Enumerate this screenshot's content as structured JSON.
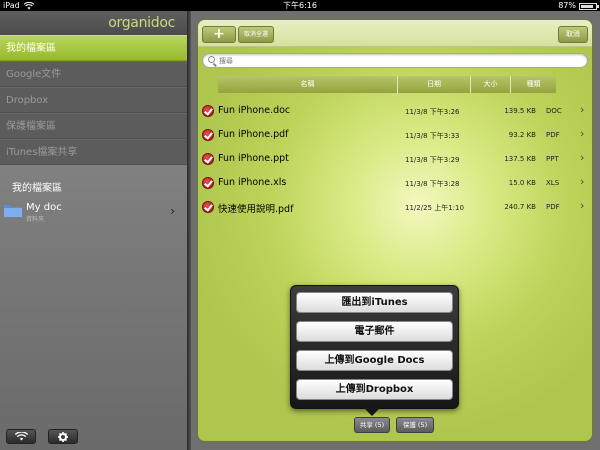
{
  "statusbar": {
    "device": "iPad",
    "time": "下午6:16",
    "battery": "87%",
    "battery_level": 0.87
  },
  "sidebar": {
    "logo": "organidoc",
    "menu": [
      {
        "label": "我的檔案區",
        "active": true
      },
      {
        "label": "Google文件",
        "active": false
      },
      {
        "label": "Dropbox",
        "active": false
      },
      {
        "label": "保護檔案區",
        "active": false
      },
      {
        "label": "iTunes檔案共享",
        "active": false
      }
    ],
    "section_title": "我的檔案區",
    "folder": {
      "name": "My doc",
      "sub": "資料夾"
    }
  },
  "toolbar": {
    "add_label": "+",
    "select_all_label": "取消全選",
    "cancel_label": "取消"
  },
  "search": {
    "placeholder": "搜尋"
  },
  "table": {
    "columns": {
      "name": "名稱",
      "date": "日期",
      "size": "大小",
      "type": "種類"
    },
    "rows": [
      {
        "name": "Fun iPhone.doc",
        "date": "11/3/8 下午3:26",
        "size": "139.5 KB",
        "type": "DOC"
      },
      {
        "name": "Fun iPhone.pdf",
        "date": "11/3/8 下午3:33",
        "size": "93.2 KB",
        "type": "PDF"
      },
      {
        "name": "Fun iPhone.ppt",
        "date": "11/3/8 下午3:29",
        "size": "137.5 KB",
        "type": "PPT"
      },
      {
        "name": "Fun iPhone.xls",
        "date": "11/3/8 下午3:28",
        "size": "15.0 KB",
        "type": "XLS"
      },
      {
        "name": "快速使用說明.pdf",
        "date": "11/2/25 上午1:10",
        "size": "240.7 KB",
        "type": "PDF"
      }
    ]
  },
  "share_menu": {
    "items": [
      "匯出到iTunes",
      "電子郵件",
      "上傳到Google Docs",
      "上傳到Dropbox"
    ]
  },
  "bottom": {
    "share_label": "共享 (5)",
    "protect_label": "保護 (5)"
  },
  "colors": {
    "accent": "#a8c63e",
    "check": "#c0202a",
    "sidebar": "#5c5c5c"
  }
}
